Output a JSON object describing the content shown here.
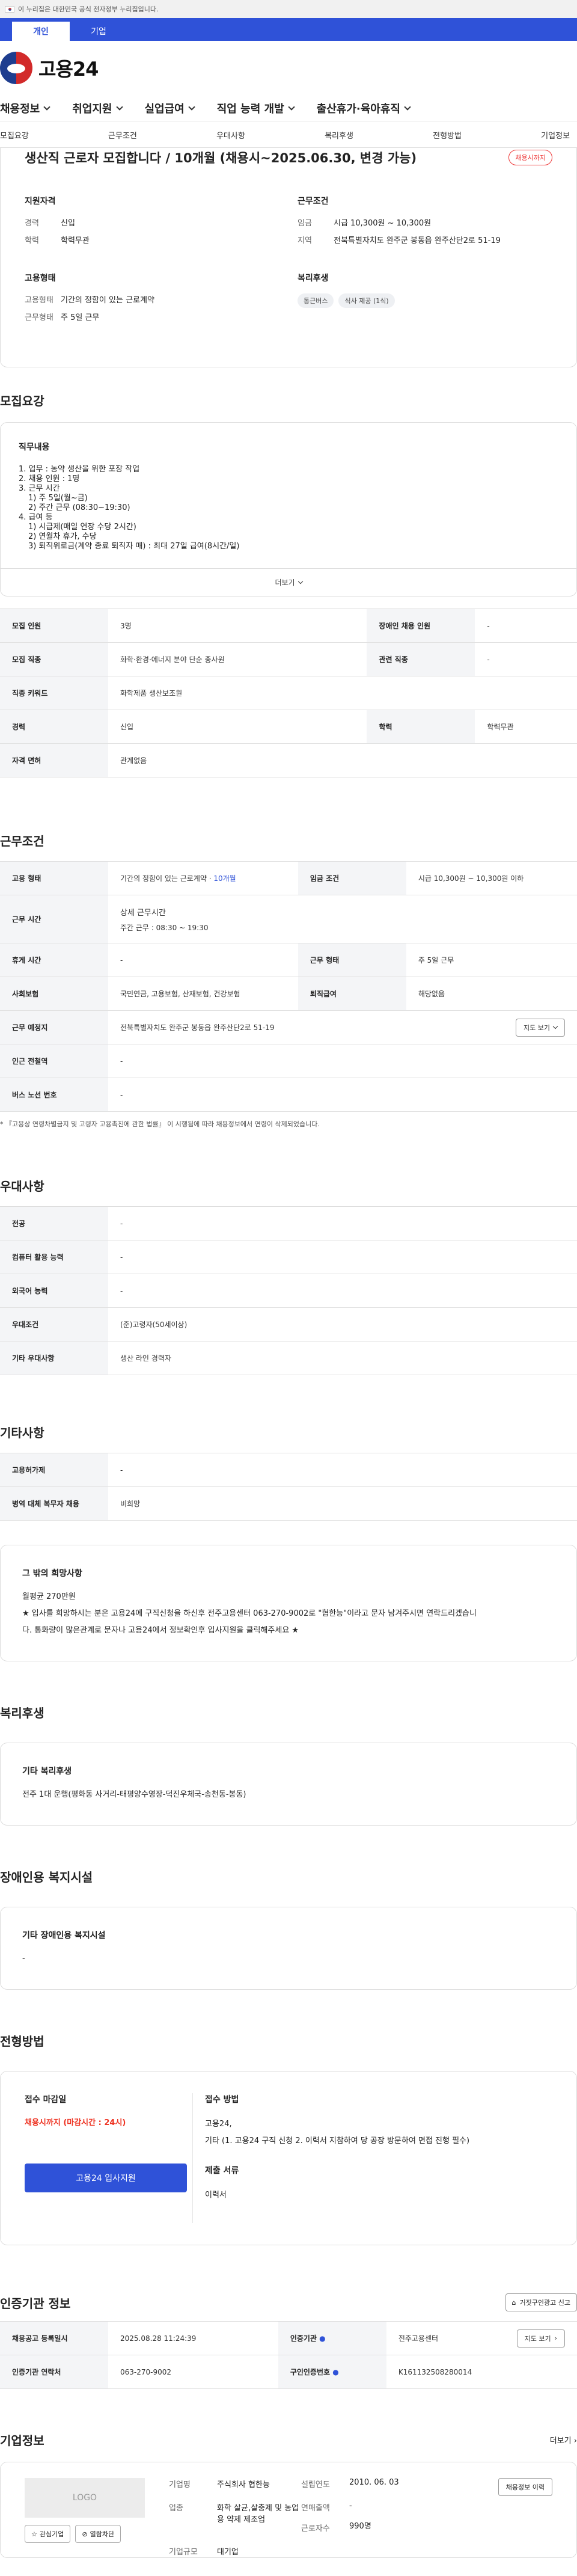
{
  "gov_banner": "이 누리집은 대한민국 공식 전자정부 누리집입니다.",
  "top_tabs": [
    "개인",
    "기업"
  ],
  "logo_text": "고용24",
  "main_nav": [
    "채용정보",
    "취업지원",
    "실업급여",
    "직업 능력 개발",
    "출산휴가·육아휴직"
  ],
  "sub_tabs": [
    "모집요강",
    "근무조건",
    "우대사항",
    "복리후생",
    "전형방법",
    "기업정보"
  ],
  "hero": {
    "title": "생산직 근로자 모집합니다 / 10개월 (채용시~2025.06.30, 변경 가능)",
    "status": "채용시까지",
    "qualification": {
      "heading": "지원자격",
      "rows": [
        [
          "경력",
          "신입"
        ],
        [
          "학력",
          "학력무관"
        ]
      ]
    },
    "conditions": {
      "heading": "근무조건",
      "rows": [
        [
          "임금",
          "시급 10,300원 ~ 10,300원"
        ],
        [
          "지역",
          "전북특별자치도 완주군 봉동읍 완주산단2로 51-19"
        ]
      ]
    },
    "employment": {
      "heading": "고용형태",
      "rows": [
        [
          "고용형태",
          "기간의 정함이 있는 근로계약"
        ],
        [
          "근무형태",
          "주 5일 근무"
        ]
      ]
    },
    "welfare": {
      "heading": "복리후생",
      "chips": [
        "통근버스",
        "식사 제공 (1식)"
      ]
    }
  },
  "recruit": {
    "title": "모집요강",
    "duty_heading": "직무내용",
    "duty_lines": [
      "1. 업무 : 농약 생산을 위한 포장 작업",
      "2. 채용 인원 : 1명",
      "3. 근무 시간",
      "    1) 주 5일(월~금)",
      "    2) 주간 근무 (08:30~19:30)",
      "4. 급여 등",
      "    1) 시급제(매일 연장 수당 2시간)",
      "    2) 연월차 휴가, 수당",
      "    3) 퇴직위로금(계약 종료 퇴직자 매) : 최대 27일 급여(8시간/일)"
    ],
    "more": "더보기",
    "table": [
      [
        [
          "모집 인원",
          "3명"
        ],
        [
          "장애인 채용 인원",
          "-"
        ]
      ],
      [
        [
          "모집 직종",
          "화학·환경·에너지 분야 단순 종사원"
        ],
        [
          "관련 직종",
          "-"
        ]
      ],
      [
        [
          "직종 키워드",
          "화학제품 생산보조원"
        ]
      ],
      [
        [
          "경력",
          "신입"
        ],
        [
          "학력",
          "학력무관"
        ]
      ],
      [
        [
          "자격 면허",
          "관계없음"
        ]
      ]
    ]
  },
  "work": {
    "title": "근무조건",
    "employment_type_label": "고용 형태",
    "employment_type_value": "기간의 정함이 있는 근로계약 · ",
    "employment_type_period": "10개월",
    "wage_label": "임금 조건",
    "wage_value": "시급 10,300원 ~ 10,300원 이하",
    "hours_label": "근무 시간",
    "hours_heading": "상세 근무시간",
    "hours_value": "주간 근무 : 08:30 ~ 19:30",
    "rest_label": "휴게 시간",
    "rest_value": "-",
    "form_label": "근무 형태",
    "form_value": "주 5일 근무",
    "insurance_label": "사회보험",
    "insurance_value": "국민연금, 고용보험, 산재보험, 건강보험",
    "severance_label": "퇴직급여",
    "severance_value": "해당없음",
    "location_label": "근무 예정지",
    "location_value": "전북특별자치도 완주군 봉동읍 완주산단2로 51-19",
    "map_btn": "지도 보기",
    "subway_label": "인근 전철역",
    "subway_value": "-",
    "bus_label": "버스 노선 번호",
    "bus_value": "-",
    "note": "* 『고용상 연령차별금지 및 고령자 고용촉진에 관한 법률』 이 시행됨에 따라 채용정보에서 연령이 삭제되었습니다."
  },
  "preference": {
    "title": "우대사항",
    "rows": [
      [
        "전공",
        "-"
      ],
      [
        "컴퓨터 활용 능력",
        "-"
      ],
      [
        "외국어 능력",
        "-"
      ],
      [
        "우대조건",
        "(준)고령자(50세이상)"
      ],
      [
        "기타 우대사항",
        "생산 라인 경력자"
      ]
    ]
  },
  "etc": {
    "title": "기타사항",
    "rows": [
      [
        "고용허가제",
        "-"
      ],
      [
        "병역 대체 복무자 채용",
        "비희망"
      ]
    ],
    "box_heading": "그 밖의 희망사항",
    "box_lines": [
      "월평균 270만원",
      "★ 입사를 희망하시는 분은 고용24에 구직신청을 하신후 전주고용센터 063-270-9002로 \"협한능\"이라고 문자 남겨주시면 연락드리겠습니",
      "다. 통화량이 많은관계로 문자나 고용24에서 정보확인후 입사지원을 클릭해주세요 ★"
    ]
  },
  "welfare": {
    "title": "복리후생",
    "box_heading": "기타 복리후생",
    "box_text": "전주 1대 운행(평화동 사거리-태평양수영장-덕진우체국-송천동-봉동)"
  },
  "disability": {
    "title": "장애인용 복지시설",
    "box_heading": "기타 장애인용 복지시설",
    "box_text": "-"
  },
  "selection": {
    "title": "전형방법",
    "deadline_heading": "접수 마감일",
    "deadline_value": "채용시까지 (마감시간 : 24시)",
    "apply_btn": "고용24 입사지원",
    "method_heading": "접수 방법",
    "method_lines": [
      "고용24,",
      "기타 (1. 고용24 구직 신청    2. 이력서 지참하여 당 공장 방문하여 면접 진행 필수)"
    ],
    "docs_heading": "제출 서류",
    "docs_value": "이력서"
  },
  "agency": {
    "title": "인증기관 정보",
    "report_btn": "거짓구인광고 신고",
    "rows": [
      [
        [
          "채용공고 등록일시",
          "2025.08.28 11:24:39"
        ],
        [
          "인증기관",
          "전주고용센터"
        ]
      ],
      [
        [
          "인증기관 연락처",
          "063-270-9002"
        ],
        [
          "구인인증번호",
          "K161132508280014"
        ]
      ]
    ],
    "map_btn": "지도 보기"
  },
  "company": {
    "title": "기업정보",
    "more": "더보기",
    "logo": "LOGO",
    "fav_btn": "관심기업",
    "interview_btn": "열람차단",
    "name_label": "기업명",
    "name_value": "주식회사 협한능",
    "established_label": "설립연도",
    "established_value": "2010. 06. 03",
    "industry_label": "업종",
    "industry_value": "화학 살균,살충제 및 농업용 약제 제조업",
    "sales_label": "연매출액",
    "sales_value": "-",
    "employees_label": "근로자수",
    "employees_value": "990명",
    "size_label": "기업규모",
    "size_value": "대기업",
    "history_btn": "채용정보 이력"
  }
}
